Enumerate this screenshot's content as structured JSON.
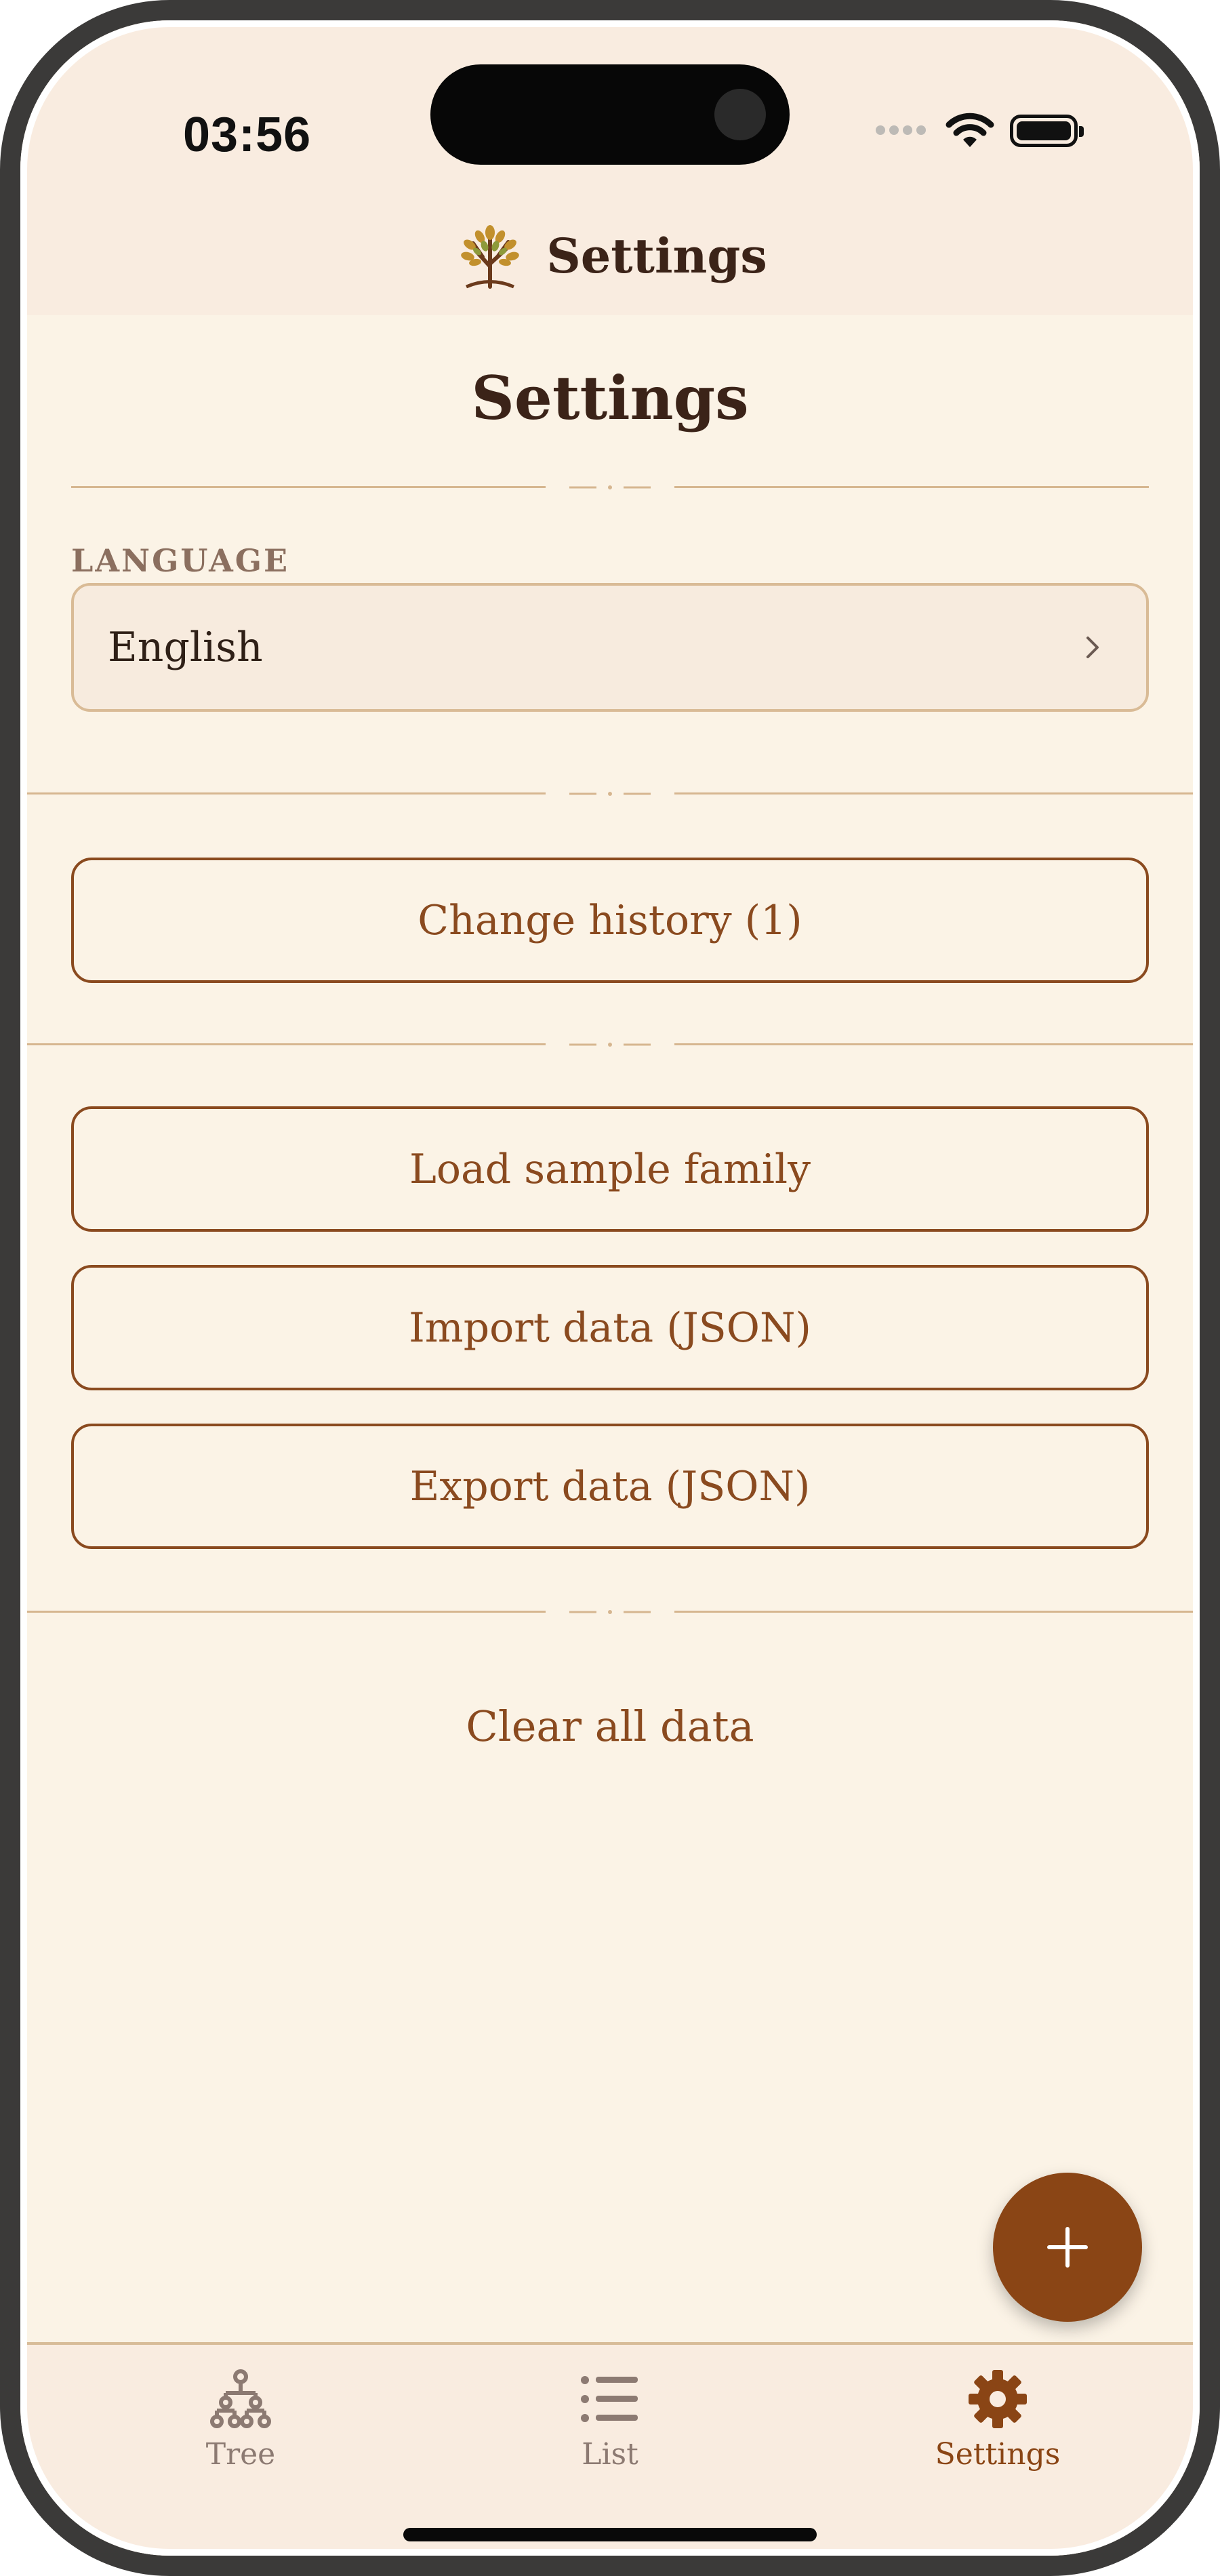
{
  "status_bar": {
    "time": "03:56"
  },
  "nav_bar": {
    "title": "Settings",
    "logo": "tree-logo-icon"
  },
  "page": {
    "title": "Settings"
  },
  "language_section": {
    "label": "LANGUAGE",
    "selected": "English"
  },
  "buttons": {
    "change_history": "Change history (1)",
    "load_sample": "Load sample family",
    "import": "Import data (JSON)",
    "export": "Export data (JSON)",
    "clear": "Clear all data"
  },
  "fab": {
    "icon": "plus-icon"
  },
  "tabs": [
    {
      "label": "Tree",
      "icon": "family-tree-icon",
      "active": false
    },
    {
      "label": "List",
      "icon": "list-icon",
      "active": false
    },
    {
      "label": "Settings",
      "icon": "gear-icon",
      "active": true
    }
  ],
  "colors": {
    "accent": "#8a4a1f",
    "background": "#fbf3e6",
    "bar_background": "#f9ece0",
    "inactive_tab": "#8c7a72",
    "title_text": "#3b2318"
  }
}
